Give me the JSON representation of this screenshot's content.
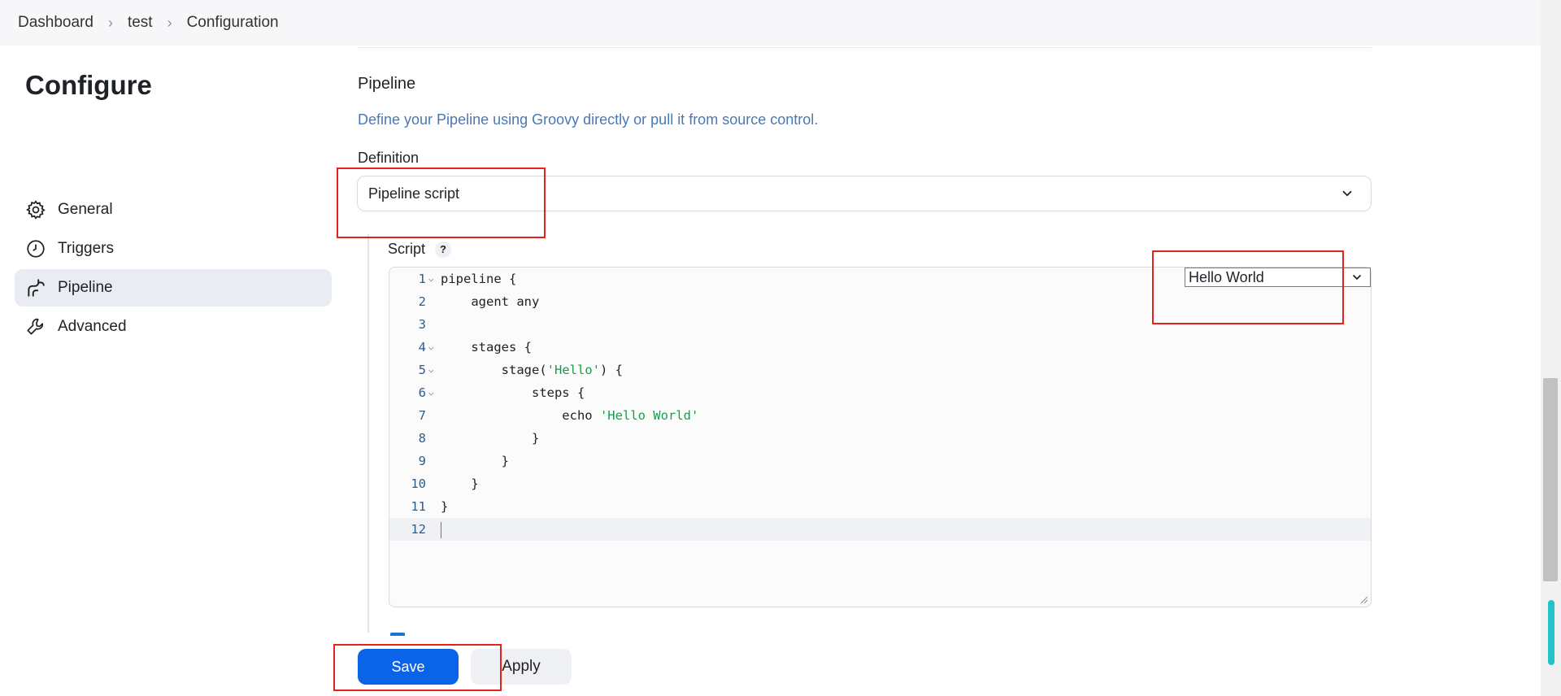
{
  "breadcrumb": {
    "items": [
      "Dashboard",
      "test",
      "Configuration"
    ]
  },
  "page": {
    "title": "Configure"
  },
  "sidebar": {
    "items": [
      {
        "label": "General",
        "icon": "gear-icon"
      },
      {
        "label": "Triggers",
        "icon": "clock-icon"
      },
      {
        "label": "Pipeline",
        "icon": "pipeline-icon",
        "active": true
      },
      {
        "label": "Advanced",
        "icon": "wrench-icon"
      }
    ]
  },
  "pipeline": {
    "title": "Pipeline",
    "description": "Define your Pipeline using Groovy directly or pull it from source control.",
    "definition_label": "Definition",
    "definition_value": "Pipeline script",
    "script_label": "Script",
    "help": "?",
    "sample_value": "Hello World",
    "code_lines": [
      "pipeline {",
      "    agent any",
      "",
      "    stages {",
      "        stage('Hello') {",
      "            steps {",
      "                echo 'Hello World'",
      "            }",
      "        }",
      "    }",
      "}",
      ""
    ]
  },
  "buttons": {
    "save": "Save",
    "apply": "Apply"
  },
  "colors": {
    "accent": "#0b63e8",
    "highlight": "#e2231a",
    "string": "#12a14b",
    "link_text": "#4a78b4"
  }
}
